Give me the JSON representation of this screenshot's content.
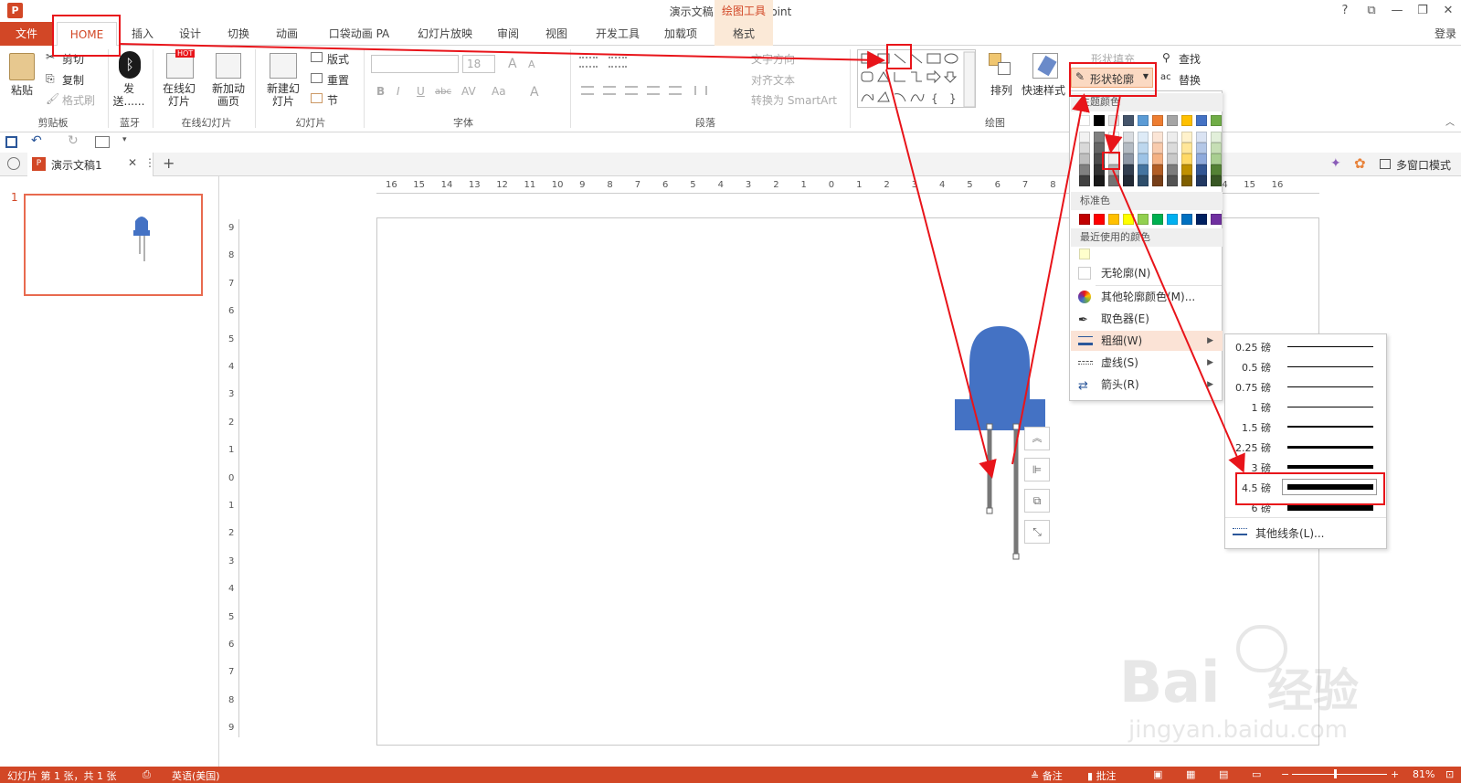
{
  "window": {
    "title": "演示文稿1 - PowerPoint",
    "drawing_tools": "绘图工具",
    "login": "登录",
    "help": "?",
    "restore_ribbon": "⧉",
    "minimize": "—",
    "maximize": "❐",
    "close": "✕"
  },
  "tabs": [
    "文件",
    "HOME",
    "插入",
    "设计",
    "切换",
    "动画",
    "口袋动画 PA",
    "幻灯片放映",
    "审阅",
    "视图",
    "开发工具",
    "加载项",
    "格式"
  ],
  "ribbon": {
    "clipboard": {
      "paste": "粘贴",
      "cut": "剪切",
      "copy": "复制",
      "format_painter": "格式刷",
      "label": "剪贴板"
    },
    "bluetooth": {
      "send": "发送......",
      "label": "蓝牙"
    },
    "online": {
      "online_slides": "在线幻灯片",
      "new_anim": "新加动画页",
      "hot": "HOT",
      "label": "在线幻灯片"
    },
    "slides": {
      "new_slide": "新建幻灯片",
      "layout": "版式",
      "reset": "重置",
      "section": "节",
      "label": "幻灯片"
    },
    "font": {
      "size": "18",
      "label": "字体",
      "grow": "A",
      "shrink": "A",
      "bold": "B",
      "italic": "I",
      "underline": "U",
      "strike": "abc",
      "spacing": "AV",
      "case": "Aa",
      "color": "A"
    },
    "paragraph": {
      "text_direction": "文字方向",
      "align_text": "对齐文本",
      "smartart": "转换为 SmartArt",
      "label": "段落"
    },
    "drawing": {
      "arrange": "排列",
      "quick_styles": "快速样式",
      "shape_fill": "形状填充",
      "shape_outline": "形状轮廓",
      "label": "绘图"
    },
    "editing": {
      "find": "查找",
      "replace": "替换"
    }
  },
  "doc_tab": {
    "name": "演示文稿1",
    "multiwindow": "多窗口模式"
  },
  "thumbnails": [
    {
      "number": "1"
    }
  ],
  "hruler_ticks": [
    "16",
    "15",
    "14",
    "13",
    "12",
    "11",
    "10",
    "9",
    "8",
    "7",
    "6",
    "5",
    "4",
    "3",
    "2",
    "1",
    "0",
    "1",
    "2",
    "3",
    "4",
    "5",
    "6",
    "7",
    "8",
    "9",
    "10",
    "11",
    "12",
    "13",
    "14",
    "15",
    "16"
  ],
  "vruler_ticks": [
    "9",
    "8",
    "7",
    "6",
    "5",
    "4",
    "3",
    "2",
    "1",
    "0",
    "1",
    "2",
    "3",
    "4",
    "5",
    "6",
    "7",
    "8",
    "9"
  ],
  "outline_menu": {
    "theme_colors_label": "主题颜色",
    "standard_colors_label": "标准色",
    "recent_colors_label": "最近使用的颜色",
    "no_outline": "无轮廓(N)",
    "more_colors": "其他轮廓颜色(M)...",
    "eyedropper": "取色器(E)",
    "weight": "粗细(W)",
    "dashes": "虚线(S)",
    "arrows": "箭头(R)",
    "theme_top": [
      "#ffffff",
      "#000000",
      "#e7e6e6",
      "#44546a",
      "#5b9bd5",
      "#ed7d31",
      "#a5a5a5",
      "#ffc000",
      "#4472c4",
      "#70ad47"
    ],
    "standard": [
      "#c00000",
      "#ff0000",
      "#ffc000",
      "#ffff00",
      "#92d050",
      "#00b050",
      "#00b0f0",
      "#0070c0",
      "#002060",
      "#7030a0"
    ],
    "recent": [
      "#ffffcc"
    ]
  },
  "weight_menu": {
    "items": [
      {
        "label": "0.25 磅",
        "pt": 0.25
      },
      {
        "label": "0.5 磅",
        "pt": 0.5
      },
      {
        "label": "0.75 磅",
        "pt": 0.75
      },
      {
        "label": "1 磅",
        "pt": 1
      },
      {
        "label": "1.5 磅",
        "pt": 1.5
      },
      {
        "label": "2.25 磅",
        "pt": 2.25
      },
      {
        "label": "3 磅",
        "pt": 3
      },
      {
        "label": "4.5 磅",
        "pt": 4.5
      },
      {
        "label": "6 磅",
        "pt": 6
      }
    ],
    "selected": "4.5 磅",
    "more_lines": "其他线条(L)..."
  },
  "status": {
    "slide_info": "幻灯片 第 1 张，共 1 张",
    "language": "英语(美国)",
    "notes": "备注",
    "comments": "批注",
    "zoom": "81%"
  },
  "watermark": {
    "brand": "Bai",
    "brand2": "经验",
    "url": "jingyan.baidu.com"
  },
  "colors": {
    "accent": "#d24726",
    "led_blue": "#4472c4",
    "annotation_red": "#e8141a"
  }
}
